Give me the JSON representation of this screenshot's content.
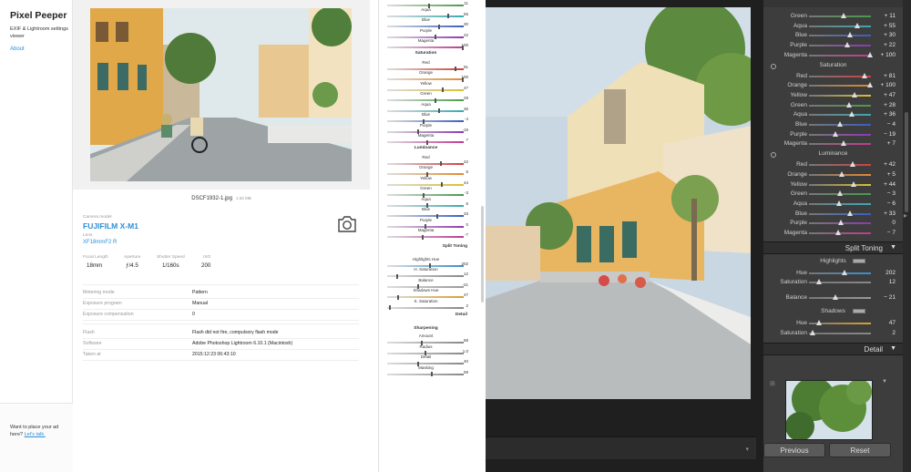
{
  "sidebar": {
    "title": "Pixel Peeper",
    "subtitle": "EXIF & Lightroom settings viewer",
    "about": "About",
    "ad_text": "Want to place your ad here?",
    "ad_link": "Let's talk."
  },
  "photo": {
    "filename": "DSCF1932-1.jpg",
    "filesize": "1.63 MB"
  },
  "exif": {
    "camera_label": "Camera model",
    "camera": "FUJIFILM X-M1",
    "lens_label": "Lens",
    "lens": "XF18mmF2 R",
    "focal_label": "Focal Length",
    "focal": "18mm",
    "aperture_label": "Aperture",
    "aperture": "ƒ/4.5",
    "shutter_label": "Shutter Speed",
    "shutter": "1/160s",
    "iso_label": "ISO",
    "iso": "200",
    "details": [
      {
        "label": "Metering mode",
        "value": "Pattern"
      },
      {
        "label": "Exposure program",
        "value": "Manual"
      },
      {
        "label": "Exposure compensation",
        "value": "0"
      },
      {
        "label": "Flash",
        "value": "Flash did not fire, compulsory flash mode"
      },
      {
        "label": "Software",
        "value": "Adobe Photoshop Lightroom 6.10.1 (Macintosh)"
      },
      {
        "label": "Taken at",
        "value": "2015:12:23 06:43:10"
      }
    ]
  },
  "adjust": {
    "hue_rows": [
      {
        "label": "Green",
        "value": "11",
        "pos": 0.55,
        "color": "#4a9a4a"
      },
      {
        "label": "Aqua",
        "value": "55",
        "pos": 0.8,
        "color": "#3aa9b0"
      },
      {
        "label": "Blue",
        "value": "30",
        "pos": 0.68,
        "color": "#3a5fbf"
      },
      {
        "label": "Purple",
        "value": "22",
        "pos": 0.63,
        "color": "#8e3ab0"
      },
      {
        "label": "Magenta",
        "value": "100",
        "pos": 1.0,
        "color": "#c03a90"
      }
    ],
    "sat_title": "Saturation",
    "sat_rows": [
      {
        "label": "Red",
        "value": "81",
        "pos": 0.9,
        "color": "#d04040"
      },
      {
        "label": "Orange",
        "value": "100",
        "pos": 1.0,
        "color": "#e08a30"
      },
      {
        "label": "Yellow",
        "value": "47",
        "pos": 0.73,
        "color": "#d9c030"
      },
      {
        "label": "Green",
        "value": "28",
        "pos": 0.64,
        "color": "#4a9a4a"
      },
      {
        "label": "Aqua",
        "value": "36",
        "pos": 0.68,
        "color": "#3aa9b0"
      },
      {
        "label": "Blue",
        "value": "-4",
        "pos": 0.48,
        "color": "#3a5fbf"
      },
      {
        "label": "Purple",
        "value": "-19",
        "pos": 0.4,
        "color": "#8e3ab0"
      },
      {
        "label": "Magenta",
        "value": "7",
        "pos": 0.53,
        "color": "#c03a90"
      }
    ],
    "lum_title": "Luminance",
    "lum_rows": [
      {
        "label": "Red",
        "value": "42",
        "pos": 0.71,
        "color": "#d04040"
      },
      {
        "label": "Orange",
        "value": "5",
        "pos": 0.52,
        "color": "#e08a30"
      },
      {
        "label": "Yellow",
        "value": "44",
        "pos": 0.72,
        "color": "#d9c030"
      },
      {
        "label": "Green",
        "value": "-3",
        "pos": 0.48,
        "color": "#4a9a4a"
      },
      {
        "label": "Aqua",
        "value": "6",
        "pos": 0.53,
        "color": "#3aa9b0"
      },
      {
        "label": "Blue",
        "value": "33",
        "pos": 0.66,
        "color": "#3a5fbf"
      },
      {
        "label": "Purple",
        "value": "0",
        "pos": 0.5,
        "color": "#8e3ab0"
      },
      {
        "label": "Magenta",
        "value": "-7",
        "pos": 0.46,
        "color": "#c03a90"
      }
    ],
    "split_title": "Split Toning",
    "split_rows": [
      {
        "label": "Highlights Hue",
        "value": "202",
        "pos": 0.56,
        "color": "#3a8fd0"
      },
      {
        "label": "H. Saturation",
        "value": "12",
        "pos": 0.12,
        "color": "#888"
      },
      {
        "label": "Balance",
        "value": "-21",
        "pos": 0.4,
        "color": "#999"
      },
      {
        "label": "Shadows Hue",
        "value": "47",
        "pos": 0.13,
        "color": "#d9a030"
      },
      {
        "label": "S. Saturation",
        "value": "2",
        "pos": 0.02,
        "color": "#888"
      }
    ],
    "detail_title": "Detail",
    "sharp_title": "Sharpening",
    "sharp_rows": [
      {
        "label": "Amount",
        "value": "68",
        "pos": 0.45,
        "color": "#888"
      },
      {
        "label": "Radius",
        "value": "1.0",
        "pos": 0.5,
        "color": "#888"
      },
      {
        "label": "Detail",
        "value": "40",
        "pos": 0.4,
        "color": "#888"
      },
      {
        "label": "Masking",
        "value": "59",
        "pos": 0.59,
        "color": "#888"
      }
    ]
  },
  "lightroom": {
    "hue_rows": [
      {
        "label": "Green",
        "value": "+ 11",
        "pos": 0.55,
        "color": "#4a9a4a"
      },
      {
        "label": "Aqua",
        "value": "+ 55",
        "pos": 0.78,
        "color": "#3aa9b0"
      },
      {
        "label": "Blue",
        "value": "+ 30",
        "pos": 0.65,
        "color": "#3a5fbf"
      },
      {
        "label": "Purple",
        "value": "+ 22",
        "pos": 0.61,
        "color": "#8e3ab0"
      },
      {
        "label": "Magenta",
        "value": "+ 100",
        "pos": 1.0,
        "color": "#c03a90"
      }
    ],
    "sat_title": "Saturation",
    "sat_rows": [
      {
        "label": "Red",
        "value": "+ 81",
        "pos": 0.9,
        "color": "#d04040"
      },
      {
        "label": "Orange",
        "value": "+ 100",
        "pos": 1.0,
        "color": "#e08a30"
      },
      {
        "label": "Yellow",
        "value": "+ 47",
        "pos": 0.74,
        "color": "#d9c030"
      },
      {
        "label": "Green",
        "value": "+ 28",
        "pos": 0.64,
        "color": "#4a9a4a"
      },
      {
        "label": "Aqua",
        "value": "+ 36",
        "pos": 0.68,
        "color": "#3aa9b0"
      },
      {
        "label": "Blue",
        "value": "− 4",
        "pos": 0.48,
        "color": "#3a5fbf"
      },
      {
        "label": "Purple",
        "value": "− 19",
        "pos": 0.41,
        "color": "#8e3ab0"
      },
      {
        "label": "Magenta",
        "value": "+ 7",
        "pos": 0.54,
        "color": "#c03a90"
      }
    ],
    "lum_title": "Luminance",
    "lum_rows": [
      {
        "label": "Red",
        "value": "+ 42",
        "pos": 0.71,
        "color": "#d04040"
      },
      {
        "label": "Orange",
        "value": "+ 5",
        "pos": 0.52,
        "color": "#e08a30"
      },
      {
        "label": "Yellow",
        "value": "+ 44",
        "pos": 0.72,
        "color": "#d9c030"
      },
      {
        "label": "Green",
        "value": "− 3",
        "pos": 0.48,
        "color": "#4a9a4a"
      },
      {
        "label": "Aqua",
        "value": "− 6",
        "pos": 0.47,
        "color": "#3aa9b0"
      },
      {
        "label": "Blue",
        "value": "+ 33",
        "pos": 0.66,
        "color": "#3a5fbf"
      },
      {
        "label": "Purple",
        "value": "0",
        "pos": 0.5,
        "color": "#8e3ab0"
      },
      {
        "label": "Magenta",
        "value": "− 7",
        "pos": 0.46,
        "color": "#c03a90"
      }
    ],
    "split_title": "Split Toning",
    "highlights_label": "Highlights",
    "hl_rows": [
      {
        "label": "Hue",
        "value": "202",
        "pos": 0.56,
        "color": "#3a8fd0"
      },
      {
        "label": "Saturation",
        "value": "12",
        "pos": 0.12,
        "color": "#888"
      }
    ],
    "balance_row": {
      "label": "Balance",
      "value": "− 21",
      "pos": 0.4,
      "color": "#999"
    },
    "shadows_label": "Shadows",
    "sh_rows": [
      {
        "label": "Hue",
        "value": "47",
        "pos": 0.13,
        "color": "#d9a030"
      },
      {
        "label": "Saturation",
        "value": "2",
        "pos": 0.02,
        "color": "#888"
      }
    ],
    "detail_title": "Detail",
    "previous": "Previous",
    "reset": "Reset"
  }
}
